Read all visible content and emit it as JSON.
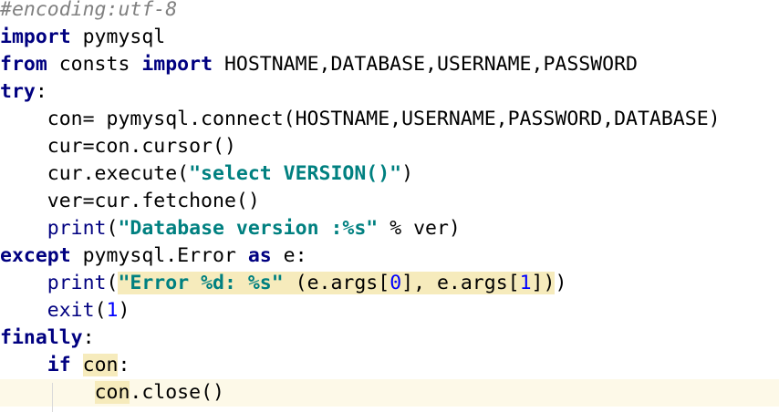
{
  "editor": {
    "language": "python",
    "colors": {
      "background": "#ffffff",
      "keyword": "#000080",
      "string": "#008080",
      "comment": "#808080",
      "number": "#0000ff",
      "highlight": "#f6ebbc",
      "current_line": "#fdf9e8"
    },
    "lines": [
      [
        {
          "t": "#encoding:utf-8",
          "c": "comment"
        }
      ],
      [
        {
          "t": "import",
          "c": "kw"
        },
        {
          "t": " pymysql",
          "c": ""
        }
      ],
      [
        {
          "t": "from",
          "c": "kw"
        },
        {
          "t": " consts ",
          "c": ""
        },
        {
          "t": "import",
          "c": "kw"
        },
        {
          "t": " HOSTNAME,DATABASE,USERNAME,PASSWORD",
          "c": ""
        }
      ],
      [
        {
          "t": "try",
          "c": "kw"
        },
        {
          "t": ":",
          "c": ""
        }
      ],
      [
        {
          "t": "    con= pymysql.connect(HOSTNAME,USERNAME,PASSWORD,DATABASE)",
          "c": ""
        }
      ],
      [
        {
          "t": "    cur=con.cursor()",
          "c": ""
        }
      ],
      [
        {
          "t": "    cur.execute(",
          "c": ""
        },
        {
          "t": "\"select VERSION()\"",
          "c": "str"
        },
        {
          "t": ")",
          "c": ""
        }
      ],
      [
        {
          "t": "    ver=cur.fetchone()",
          "c": ""
        }
      ],
      [
        {
          "t": "    ",
          "c": ""
        },
        {
          "t": "print",
          "c": "builtin"
        },
        {
          "t": "(",
          "c": ""
        },
        {
          "t": "\"Database version :%s\"",
          "c": "str"
        },
        {
          "t": " % ver)",
          "c": ""
        }
      ],
      [
        {
          "t": "except",
          "c": "kw"
        },
        {
          "t": " pymysql.Error ",
          "c": ""
        },
        {
          "t": "as",
          "c": "kw"
        },
        {
          "t": " e:",
          "c": ""
        }
      ],
      [
        {
          "t": "    ",
          "c": ""
        },
        {
          "t": "print",
          "c": "builtin"
        },
        {
          "t": "(",
          "c": ""
        },
        {
          "t": "\"Error %d: %s\"",
          "c": "str hl"
        },
        {
          "t": " (e.args[",
          "c": "hl"
        },
        {
          "t": "0",
          "c": "num hl"
        },
        {
          "t": "], e.args[",
          "c": "hl"
        },
        {
          "t": "1",
          "c": "num hl"
        },
        {
          "t": "])",
          "c": "hl"
        },
        {
          "t": ")",
          "c": ""
        }
      ],
      [
        {
          "t": "    ",
          "c": ""
        },
        {
          "t": "exit",
          "c": "builtin"
        },
        {
          "t": "(",
          "c": ""
        },
        {
          "t": "1",
          "c": "num"
        },
        {
          "t": ")",
          "c": ""
        }
      ],
      [
        {
          "t": "finally",
          "c": "kw"
        },
        {
          "t": ":",
          "c": ""
        }
      ],
      [
        {
          "t": "    ",
          "c": ""
        },
        {
          "t": "if",
          "c": "kw"
        },
        {
          "t": " ",
          "c": ""
        },
        {
          "t": "con",
          "c": "hl"
        },
        {
          "t": ":",
          "c": ""
        }
      ],
      [
        {
          "t": "        ",
          "c": ""
        },
        {
          "t": "con",
          "c": "hl"
        },
        {
          "t": ".close()",
          "c": ""
        }
      ]
    ]
  }
}
